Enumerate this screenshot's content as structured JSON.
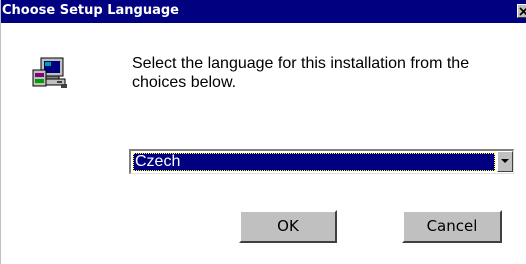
{
  "window": {
    "title": "Choose Setup Language"
  },
  "dialog": {
    "prompt": "Select the language for this installation from the choices below."
  },
  "language_select": {
    "selected": "Czech"
  },
  "buttons": {
    "ok_label": "OK",
    "cancel_label": "Cancel"
  },
  "icons": {
    "setup": "setup-computer-icon",
    "close": "close-icon",
    "dropdown": "dropdown-arrow-icon"
  },
  "colors": {
    "titlebar": "#000080",
    "selection": "#000080",
    "button_face": "#c0c0c0"
  }
}
